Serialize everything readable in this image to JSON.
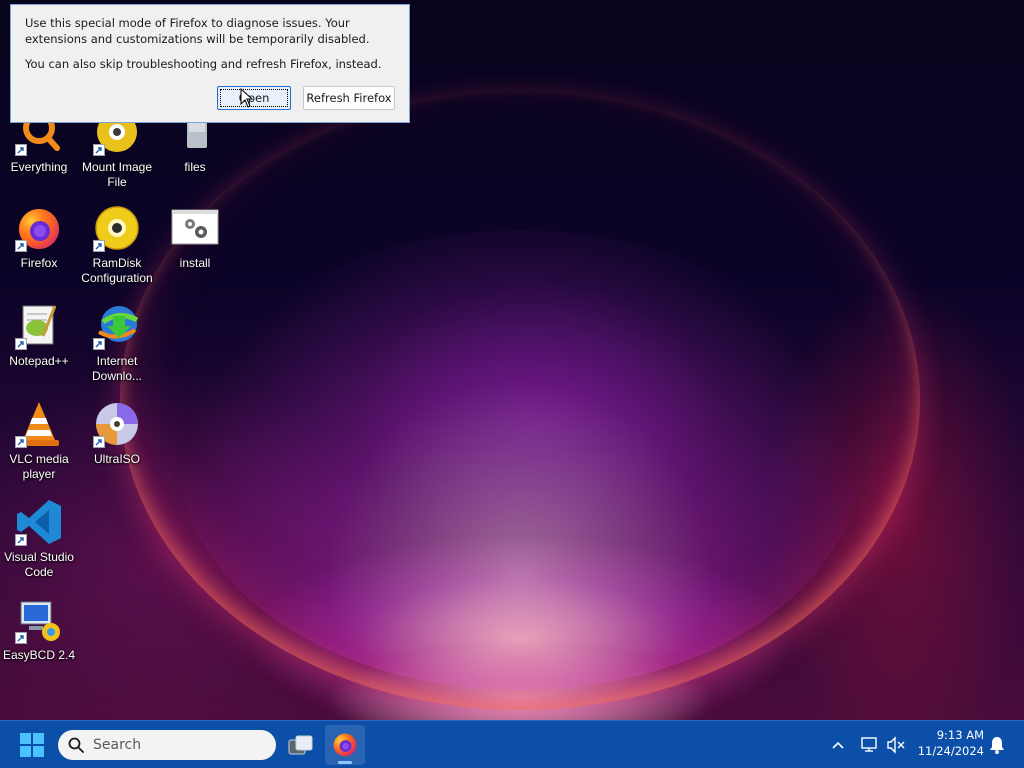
{
  "dialog": {
    "message_line1": "Use this special mode of Firefox to diagnose issues. Your extensions and customizations will be temporarily disabled.",
    "message_line2": "You can also skip troubleshooting and refresh Firefox, instead.",
    "open_label": "Open",
    "refresh_label": "Refresh Firefox"
  },
  "desktop_icons": [
    {
      "label": "Everything",
      "icon": "everything-icon"
    },
    {
      "label": "Mount Image File",
      "icon": "mount-image-icon"
    },
    {
      "label": "files",
      "icon": "files-folder-icon"
    },
    {
      "label": "Firefox",
      "icon": "firefox-icon"
    },
    {
      "label": "RamDisk Configuration",
      "icon": "ramdisk-icon"
    },
    {
      "label": "install",
      "icon": "install-icon"
    },
    {
      "label": "Notepad++",
      "icon": "notepadpp-icon"
    },
    {
      "label": "Internet Downlo...",
      "icon": "internet-download-manager-icon"
    },
    {
      "label": "VLC media player",
      "icon": "vlc-icon"
    },
    {
      "label": "UltraISO",
      "icon": "ultraiso-icon"
    },
    {
      "label": "Visual Studio Code",
      "icon": "vscode-icon"
    },
    {
      "label": "EasyBCD 2.4",
      "icon": "easybcd-icon"
    }
  ],
  "taskbar": {
    "search_placeholder": "Search",
    "apps": [
      {
        "name": "Task View",
        "icon": "task-view-icon"
      },
      {
        "name": "Firefox",
        "icon": "firefox-icon",
        "active": true
      }
    ],
    "clock_time": "9:13 AM",
    "clock_date": "11/24/2024"
  },
  "colors": {
    "taskbar": "#0b4fa8",
    "dialog_background": "#f0f0f0",
    "focus_border": "#1e6fd0"
  }
}
